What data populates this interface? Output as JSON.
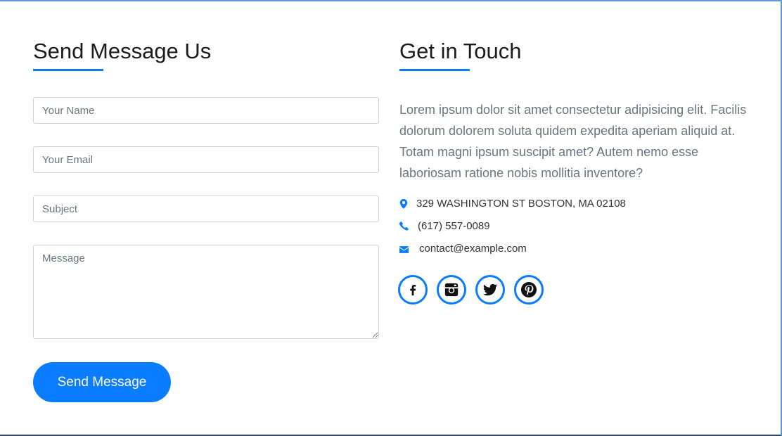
{
  "form_section": {
    "title": "Send Message Us",
    "name_placeholder": "Your Name",
    "email_placeholder": "Your Email",
    "subject_placeholder": "Subject",
    "message_placeholder": "Message",
    "submit_label": "Send Message"
  },
  "contact_section": {
    "title": "Get in Touch",
    "intro": "Lorem ipsum dolor sit amet consectetur adipisicing elit. Facilis dolorum dolorem soluta quidem expedita aperiam aliquid at. Totam magni ipsum suscipit amet? Autem nemo esse laboriosam ratione nobis mollitia inventore?",
    "address": "329 WASHINGTON ST BOSTON, MA 02108",
    "phone": "(617) 557-0089",
    "email": "contact@example.com",
    "socials": [
      {
        "icon": "facebook-icon"
      },
      {
        "icon": "instagram-icon"
      },
      {
        "icon": "twitter-icon"
      },
      {
        "icon": "pinterest-icon"
      }
    ]
  },
  "colors": {
    "accent": "#0a7cff",
    "heading": "#1b1b1b",
    "muted_text": "#6c757d"
  }
}
